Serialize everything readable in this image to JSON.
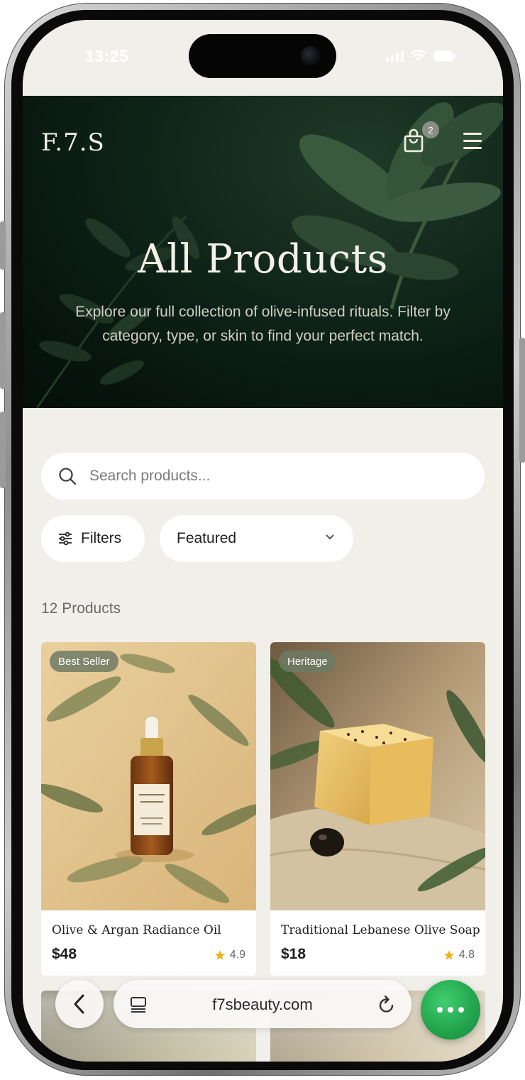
{
  "status_bar": {
    "time": "13:25"
  },
  "header": {
    "brand": "F.7.S",
    "cart_count": "2"
  },
  "hero": {
    "title": "All Products",
    "subtitle": "Explore our full collection of olive-infused rituals. Filter by category, type, or skin to find your perfect match."
  },
  "search": {
    "placeholder": "Search products..."
  },
  "filters": {
    "label": "Filters",
    "sort_selected": "Featured"
  },
  "results": {
    "count_label": "12 Products"
  },
  "products": [
    {
      "badge": "Best Seller",
      "name": "Olive & Argan Radiance Oil",
      "price": "$48",
      "rating": "4.9"
    },
    {
      "badge": "Heritage",
      "name": "Traditional Lebanese Olive Soap",
      "price": "$18",
      "rating": "4.8"
    }
  ],
  "browser": {
    "url": "f7sbeauty.com"
  },
  "colors": {
    "hero_bg": "#0f2418",
    "page_bg": "#f1efea",
    "badge_bg": "#6e7a64",
    "star": "#f2b01e",
    "more_button": "#22a24c"
  },
  "icons": [
    "search-icon",
    "sliders-icon",
    "chevron-down-icon",
    "bag-icon",
    "menu-icon",
    "star-icon",
    "back-icon",
    "tabs-icon",
    "reload-icon",
    "more-icon"
  ]
}
